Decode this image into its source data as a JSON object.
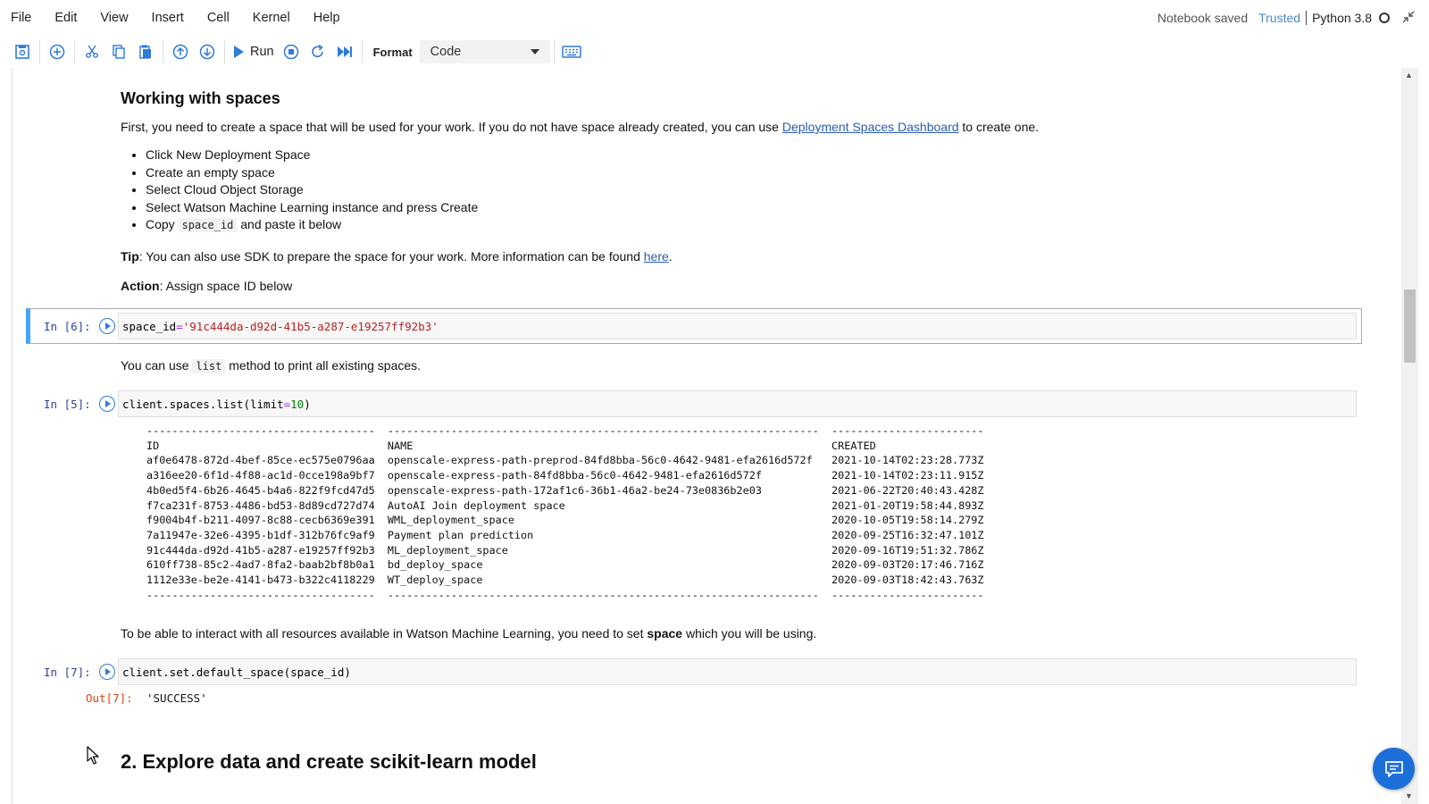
{
  "menubar": {
    "menus": [
      "File",
      "Edit",
      "View",
      "Insert",
      "Cell",
      "Kernel",
      "Help"
    ],
    "status": "Notebook saved",
    "trusted": "Trusted",
    "kernel": "Python 3.8"
  },
  "toolbar": {
    "run_label": "Run",
    "format_label": "Format",
    "format_value": "Code",
    "buttons": [
      "save-icon",
      "add-cell-icon",
      "cut-icon",
      "copy-icon",
      "paste-icon",
      "move-up-icon",
      "move-down-icon",
      "run-icon",
      "stop-icon",
      "restart-icon",
      "fast-forward-icon",
      "keyboard-icon"
    ]
  },
  "cells": {
    "md1": {
      "heading": "Working with spaces",
      "p1_before": "First, you need to create a space that will be used for your work. If you do not have space already created, you can use ",
      "p1_link": "Deployment Spaces Dashboard",
      "p1_after": " to create one.",
      "bullets": [
        "Click New Deployment Space",
        "Create an empty space",
        "Select Cloud Object Storage",
        "Select Watson Machine Learning instance and press Create"
      ],
      "bullet5_before": "Copy ",
      "bullet5_code": "space_id",
      "bullet5_after": " and paste it below",
      "tip_bold": "Tip",
      "tip_text": ": You can also use SDK to prepare the space for your work. More information can be found ",
      "tip_link": "here",
      "tip_end": ".",
      "action_bold": "Action",
      "action_text": ": Assign space ID below"
    },
    "code6": {
      "prompt": "In [6]:",
      "var": "space_id",
      "op": " = ",
      "value": "'91c444da-d92d-41b5-a287-e19257ff92b3'"
    },
    "md2": {
      "before": "You can use ",
      "code": "list",
      "after": " method to print all existing spaces."
    },
    "code5": {
      "prompt": "In [5]:",
      "code_before": "client.spaces.list(limit",
      "code_op": "=",
      "code_num": "10",
      "code_after": ")"
    },
    "spaces_table": {
      "rule_id": "------------------------------------",
      "rule_name": "--------------------------------------------------------------------",
      "rule_created": "------------------------",
      "headers": [
        "ID",
        "NAME",
        "CREATED"
      ],
      "rows": [
        [
          "af0e6478-872d-4bef-85ce-ec575e0796aa",
          "openscale-express-path-preprod-84fd8bba-56c0-4642-9481-efa2616d572f",
          "2021-10-14T02:23:28.773Z"
        ],
        [
          "a316ee20-6f1d-4f88-ac1d-0cce198a9bf7",
          "openscale-express-path-84fd8bba-56c0-4642-9481-efa2616d572f",
          "2021-10-14T02:23:11.915Z"
        ],
        [
          "4b0ed5f4-6b26-4645-b4a6-822f9fcd47d5",
          "openscale-express-path-172af1c6-36b1-46a2-be24-73e0836b2e03",
          "2021-06-22T20:40:43.428Z"
        ],
        [
          "f7ca231f-8753-4486-bd53-8d89cd727d74",
          "AutoAI Join deployment space",
          "2021-01-20T19:58:44.893Z"
        ],
        [
          "f9004b4f-b211-4097-8c88-cecb6369e391",
          "WML_deployment_space",
          "2020-10-05T19:58:14.279Z"
        ],
        [
          "7a11947e-32e6-4395-b1df-312b76fc9af9",
          "Payment plan prediction",
          "2020-09-25T16:32:47.101Z"
        ],
        [
          "91c444da-d92d-41b5-a287-e19257ff92b3",
          "ML_deployment_space",
          "2020-09-16T19:51:32.786Z"
        ],
        [
          "610ff738-85c2-4ad7-8fa2-baab2bf8b0a1",
          "bd_deploy_space",
          "2020-09-03T20:17:46.716Z"
        ],
        [
          "1112e33e-be2e-4141-b473-b322c4118229",
          "WT_deploy_space",
          "2020-09-03T18:42:43.763Z"
        ]
      ]
    },
    "md3": {
      "before": "To be able to interact with all resources available in Watson Machine Learning, you need to set ",
      "bold": "space",
      "after": " which you will be using."
    },
    "code7": {
      "prompt": "In [7]:",
      "code": "client.set.default_space(space_id)",
      "out_prompt": "Out[7]:",
      "output": "'SUCCESS'"
    },
    "md4": {
      "heading": "2. Explore data and create scikit-learn model"
    }
  }
}
